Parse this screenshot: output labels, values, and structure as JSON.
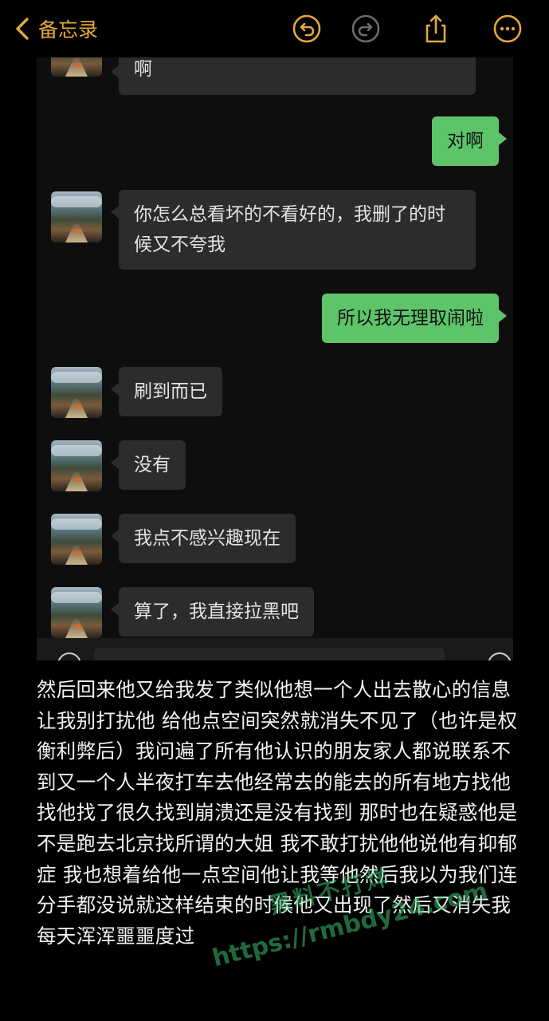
{
  "nav": {
    "back_label": "备忘录",
    "icons": [
      "undo-icon",
      "redo-icon",
      "share-icon",
      "more-icon"
    ],
    "accent": "#e5a93a"
  },
  "chat": {
    "messages": [
      {
        "side": "left",
        "text": "啊"
      },
      {
        "side": "right",
        "text": "对啊"
      },
      {
        "side": "left",
        "text": "你怎么总看坏的不看好的，我删了的时候又不夸我"
      },
      {
        "side": "right",
        "text": "所以我无理取闹啦"
      },
      {
        "side": "left",
        "text": "刷到而已"
      },
      {
        "side": "left",
        "text": "没有"
      },
      {
        "side": "left",
        "text": "我点不感兴趣现在"
      },
      {
        "side": "left",
        "text": "算了，我直接拉黑吧"
      }
    ],
    "colors": {
      "left_bubble": "#2c2c2c",
      "right_bubble": "#5dc46a",
      "background": "#0e0e0e"
    }
  },
  "note": {
    "body": "然后回来他又给我发了类似他想一个人出去散心的信息让我别打扰他 给他点空间突然就消失不见了（也许是权衡利弊后）我问遍了所有他认识的朋友家人都说联系不到又一个人半夜打车去他经常去的能去的所有地方找他找他找了很久找到崩溃还是没有找到 那时也在疑惑他是不是跑去北京找所谓的大姐 我不敢打扰他他说他有抑郁症 我也想着给他一点空间他让我等他然后我以为我们连分手都没说就这样结束的时候他又出现了然后又消失我每天浑浑噩噩度过"
  },
  "watermark": {
    "line1": "黑料不打烊",
    "line2": "https://rmbdy24.com",
    "color": "#3cbe6e"
  }
}
